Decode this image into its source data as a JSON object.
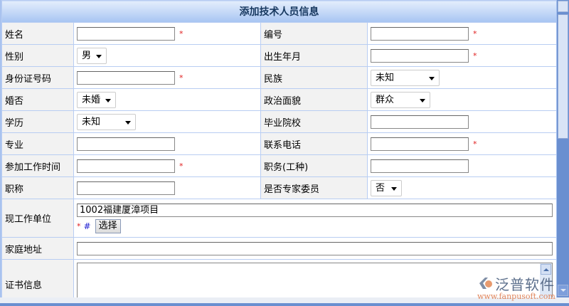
{
  "title": "添加技术人员信息",
  "rows": [
    {
      "l1": "姓名",
      "l2": "编号"
    },
    {
      "l1": "性别",
      "v1": "男",
      "l2": "出生年月"
    },
    {
      "l1": "身份证号码",
      "l2": "民族",
      "v2": "未知"
    },
    {
      "l1": "婚否",
      "v1": "未婚",
      "l2": "政治面貌",
      "v2": "群众"
    },
    {
      "l1": "学历",
      "v1": "未知",
      "l2": "毕业院校"
    },
    {
      "l1": "专业",
      "l2": "联系电话"
    },
    {
      "l1": "参加工作时间",
      "l2": "职务(工种)"
    },
    {
      "l1": "职称",
      "l2": "是否专家委员",
      "v2": "否"
    }
  ],
  "work_unit": {
    "label": "现工作单位",
    "value": "1002福建厦漳项目",
    "hash": "#",
    "select_button": "选择"
  },
  "home_address": {
    "label": "家庭地址"
  },
  "certificate": {
    "label": "证书信息"
  },
  "required_mark": "*",
  "watermark": {
    "name": "泛普软件",
    "url": "www.fanpusoft.com"
  }
}
